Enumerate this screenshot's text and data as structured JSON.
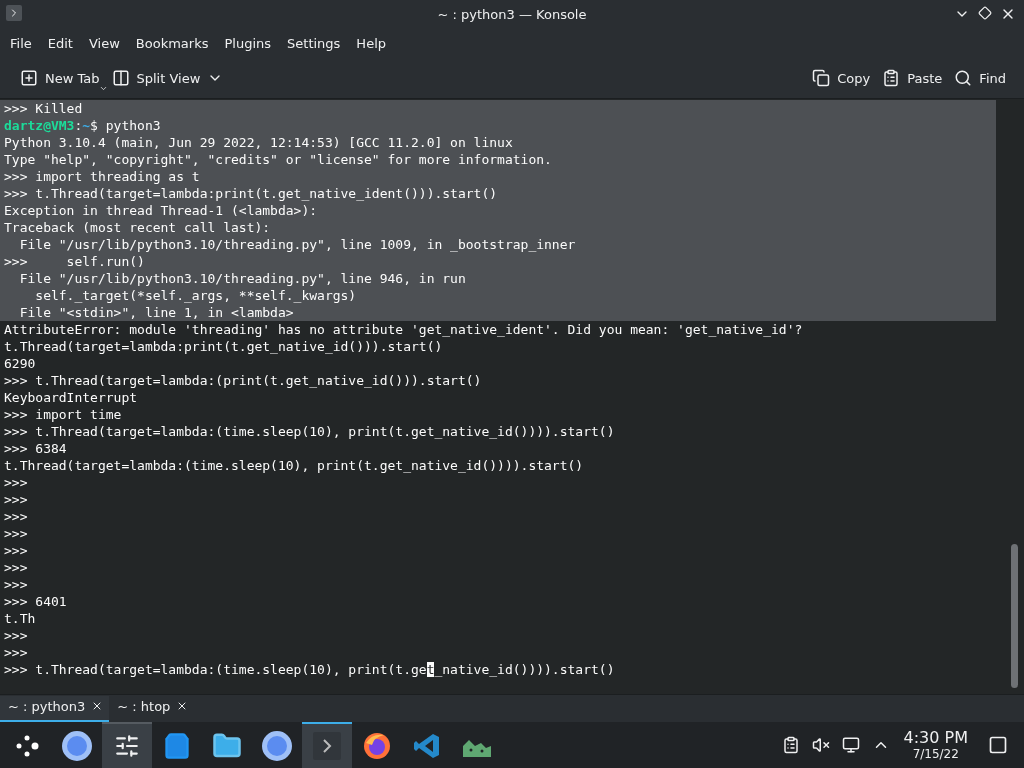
{
  "window": {
    "title": "~ : python3 — Konsole"
  },
  "menu": [
    "File",
    "Edit",
    "View",
    "Bookmarks",
    "Plugins",
    "Settings",
    "Help"
  ],
  "toolbar_left": [
    {
      "kind": "new-tab",
      "label": "New Tab"
    },
    {
      "kind": "split-view",
      "label": "Split View"
    }
  ],
  "toolbar_right": [
    {
      "kind": "copy",
      "label": "Copy"
    },
    {
      "kind": "paste",
      "label": "Paste"
    },
    {
      "kind": "find",
      "label": "Find"
    }
  ],
  "terminal": {
    "lines": [
      {
        "kind": "text",
        "text": ">>> Killed",
        "selected": true
      },
      {
        "kind": "prompt",
        "user_host": "dartz@VM3",
        "separator": ":",
        "path": "~",
        "command": "$ python3",
        "selected": true
      },
      {
        "kind": "text",
        "text": "Python 3.10.4 (main, Jun 29 2022, 12:14:53) [GCC 11.2.0] on linux",
        "selected": true
      },
      {
        "kind": "text",
        "text": "Type \"help\", \"copyright\", \"credits\" or \"license\" for more information.",
        "selected": true
      },
      {
        "kind": "text",
        "text": ">>> import threading as t",
        "selected": true
      },
      {
        "kind": "text",
        "text": ">>> t.Thread(target=lambda:print(t.get_native_ident())).start()",
        "selected": true
      },
      {
        "kind": "text",
        "text": "Exception in thread Thread-1 (<lambda>):",
        "selected": true
      },
      {
        "kind": "text",
        "text": "Traceback (most recent call last):",
        "selected": true
      },
      {
        "kind": "text",
        "text": "  File \"/usr/lib/python3.10/threading.py\", line 1009, in _bootstrap_inner",
        "selected": true
      },
      {
        "kind": "text",
        "text": ">>>     self.run()",
        "selected": true
      },
      {
        "kind": "text",
        "text": "  File \"/usr/lib/python3.10/threading.py\", line 946, in run",
        "selected": true
      },
      {
        "kind": "text",
        "text": "    self._target(*self._args, **self._kwargs)",
        "selected": true
      },
      {
        "kind": "text",
        "text": "  File \"<stdin>\", line 1, in <lambda>",
        "selected": true
      },
      {
        "kind": "text",
        "text": "AttributeError: module 'threading' has no attribute 'get_native_ident'. Did you mean: 'get_native_id'?",
        "selected": false
      },
      {
        "kind": "text",
        "text": "t.Thread(target=lambda:print(t.get_native_id())).start()",
        "selected": false
      },
      {
        "kind": "text",
        "text": "6290",
        "selected": false
      },
      {
        "kind": "text",
        "text": ">>> t.Thread(target=lambda:(print(t.get_native_id())).start()",
        "selected": false
      },
      {
        "kind": "text",
        "text": "KeyboardInterrupt",
        "selected": false
      },
      {
        "kind": "text",
        "text": ">>> import time",
        "selected": false
      },
      {
        "kind": "text",
        "text": ">>> t.Thread(target=lambda:(time.sleep(10), print(t.get_native_id()))).start()",
        "selected": false
      },
      {
        "kind": "text",
        "text": ">>> 6384",
        "selected": false
      },
      {
        "kind": "text",
        "text": "t.Thread(target=lambda:(time.sleep(10), print(t.get_native_id()))).start()",
        "selected": false
      },
      {
        "kind": "text",
        "text": ">>>",
        "selected": false
      },
      {
        "kind": "text",
        "text": ">>>",
        "selected": false
      },
      {
        "kind": "text",
        "text": ">>>",
        "selected": false
      },
      {
        "kind": "text",
        "text": ">>>",
        "selected": false
      },
      {
        "kind": "text",
        "text": ">>>",
        "selected": false
      },
      {
        "kind": "text",
        "text": ">>>",
        "selected": false
      },
      {
        "kind": "text",
        "text": ">>>",
        "selected": false
      },
      {
        "kind": "text",
        "text": ">>> 6401",
        "selected": false
      },
      {
        "kind": "text",
        "text": "t.Th",
        "selected": false
      },
      {
        "kind": "text",
        "text": ">>>",
        "selected": false
      },
      {
        "kind": "text",
        "text": ">>>",
        "selected": false
      },
      {
        "kind": "cursor",
        "before": ">>> t.Thread(target=lambda:(time.sleep(10), print(t.ge",
        "cursor": "t",
        "after": "_native_id()))).start()",
        "selected": false
      }
    ]
  },
  "tabs": [
    {
      "label": "~ : python3",
      "selected": true
    },
    {
      "label": "~ : htop",
      "selected": false
    }
  ],
  "taskbar": {
    "apps": [
      {
        "kind": "launcher",
        "active": false
      },
      {
        "kind": "browser",
        "active": false
      },
      {
        "kind": "mixer",
        "active": true
      },
      {
        "kind": "store",
        "active": false
      },
      {
        "kind": "files",
        "active": false
      },
      {
        "kind": "browser",
        "active": false
      },
      {
        "kind": "terminal",
        "active": true
      },
      {
        "kind": "firefox",
        "active": false
      },
      {
        "kind": "code",
        "active": false
      },
      {
        "kind": "monitor",
        "active": false
      }
    ],
    "tray": [
      {
        "kind": "clipboard"
      },
      {
        "kind": "muted"
      },
      {
        "kind": "network"
      },
      {
        "kind": "expand"
      }
    ],
    "clock": {
      "time": "4:30 PM",
      "date": "7/15/22"
    }
  }
}
